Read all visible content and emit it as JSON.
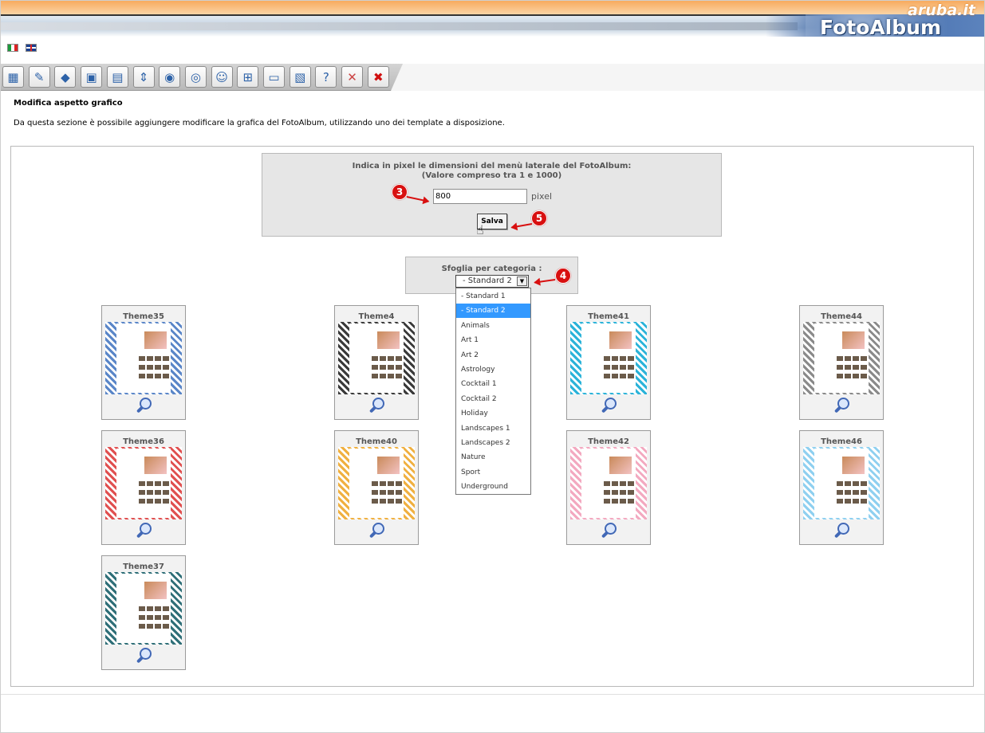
{
  "header": {
    "brand": "aruba.it",
    "app_title": "FotoAlbum"
  },
  "languages": [
    {
      "name": "italian-flag-icon"
    },
    {
      "name": "uk-flag-icon"
    }
  ],
  "toolbar": {
    "icons": [
      "calendar-icon",
      "edit-icon",
      "eraser-icon",
      "image-add-icon",
      "image-edit-icon",
      "resize-icon",
      "camera-add-icon",
      "camera-edit-icon",
      "users-icon",
      "sitemap-icon",
      "monitor-icon",
      "package-icon",
      "help-icon",
      "tools-icon",
      "cancel-icon"
    ]
  },
  "section": {
    "title": "Modifica aspetto grafico",
    "description": "Da questa sezione è possibile aggiungere modificare la grafica del FotoAlbum, utilizzando uno dei template a disposizione."
  },
  "menu_size": {
    "label_line1": "Indica in pixel le dimensioni del menù laterale del FotoAlbum:",
    "label_line2": "(Valore compreso tra 1 e 1000)",
    "value": "800",
    "unit": "pixel",
    "save_label": "Salva"
  },
  "category": {
    "label": "Sfoglia per categoria :",
    "selected": "- Standard 2",
    "options": [
      "- Standard 1",
      "- Standard 2",
      "Animals",
      "Art 1",
      "Art 2",
      "Astrology",
      "Cocktail 1",
      "Cocktail 2",
      "Holiday",
      "Landscapes 1",
      "Landscapes 2",
      "Nature",
      "Sport",
      "Underground"
    ]
  },
  "annotations": {
    "m3": "3",
    "m4": "4",
    "m5": "5"
  },
  "themes": [
    {
      "name": "Theme35",
      "accent": "#5a86c8"
    },
    {
      "name": "Theme4",
      "accent": "#3a3a3a"
    },
    {
      "name": "Theme41",
      "accent": "#2bb3d9"
    },
    {
      "name": "Theme44",
      "accent": "#8a8a8a"
    },
    {
      "name": "Theme36",
      "accent": "#e05050"
    },
    {
      "name": "Theme40",
      "accent": "#f0b040"
    },
    {
      "name": "Theme42",
      "accent": "#f3a9c0"
    },
    {
      "name": "Theme46",
      "accent": "#8fd0f0"
    },
    {
      "name": "Theme37",
      "accent": "#2f6f78"
    }
  ]
}
